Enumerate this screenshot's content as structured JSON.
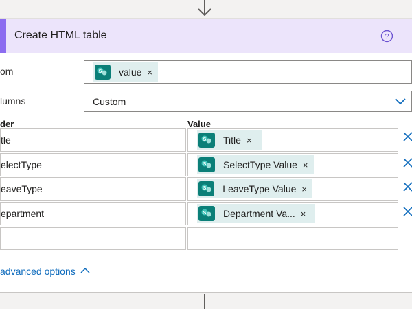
{
  "action": {
    "title": "Create HTML table",
    "accent_color": "#8c6cf0",
    "header_bg": "#ece4fb"
  },
  "from": {
    "label": "om",
    "token": {
      "icon": "sharepoint-icon",
      "text": "value",
      "remove": "×"
    }
  },
  "columns": {
    "label": "lumns",
    "selected": "Custom"
  },
  "table": {
    "header_label": "der",
    "value_label": "Value",
    "rows": [
      {
        "header": "tle",
        "value": "Title",
        "remove": "×",
        "delete": "✕"
      },
      {
        "header": "electType",
        "value": "SelectType Value",
        "remove": "×",
        "delete": "✕"
      },
      {
        "header": "eaveType",
        "value": "LeaveType Value",
        "remove": "×",
        "delete": "✕"
      },
      {
        "header": "epartment",
        "value": "Department Va...",
        "remove": "×",
        "delete": "✕"
      }
    ]
  },
  "advanced": {
    "label": "advanced options"
  }
}
